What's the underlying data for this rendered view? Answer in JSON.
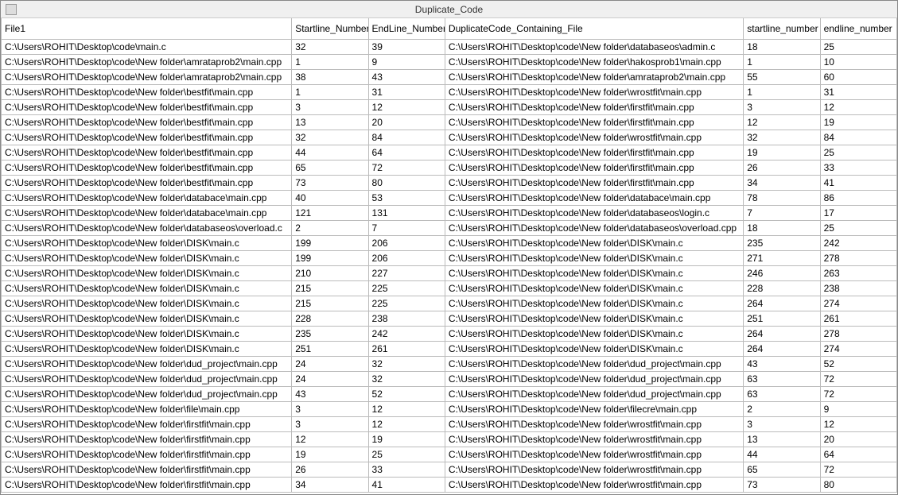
{
  "window": {
    "title": "Duplicate_Code"
  },
  "columns": {
    "file1": "File1",
    "start1": "Startline_Number",
    "end1": "EndLine_Number",
    "file2": "DuplicateCode_Containing_File",
    "start2": "startline_number",
    "end2": "endline_number"
  },
  "rows": [
    {
      "file1": "C:\\Users\\ROHIT\\Desktop\\code\\main.c",
      "start1": "32",
      "end1": "39",
      "file2": "C:\\Users\\ROHIT\\Desktop\\code\\New folder\\databaseos\\admin.c",
      "start2": "18",
      "end2": "25"
    },
    {
      "file1": "C:\\Users\\ROHIT\\Desktop\\code\\New folder\\amrataprob2\\main.cpp",
      "start1": "1",
      "end1": "9",
      "file2": "C:\\Users\\ROHIT\\Desktop\\code\\New folder\\hakosprob1\\main.cpp",
      "start2": "1",
      "end2": "10"
    },
    {
      "file1": "C:\\Users\\ROHIT\\Desktop\\code\\New folder\\amrataprob2\\main.cpp",
      "start1": "38",
      "end1": "43",
      "file2": "C:\\Users\\ROHIT\\Desktop\\code\\New folder\\amrataprob2\\main.cpp",
      "start2": "55",
      "end2": "60"
    },
    {
      "file1": "C:\\Users\\ROHIT\\Desktop\\code\\New folder\\bestfit\\main.cpp",
      "start1": "1",
      "end1": "31",
      "file2": "C:\\Users\\ROHIT\\Desktop\\code\\New folder\\wrostfit\\main.cpp",
      "start2": "1",
      "end2": "31"
    },
    {
      "file1": "C:\\Users\\ROHIT\\Desktop\\code\\New folder\\bestfit\\main.cpp",
      "start1": "3",
      "end1": "12",
      "file2": "C:\\Users\\ROHIT\\Desktop\\code\\New folder\\firstfit\\main.cpp",
      "start2": "3",
      "end2": "12"
    },
    {
      "file1": "C:\\Users\\ROHIT\\Desktop\\code\\New folder\\bestfit\\main.cpp",
      "start1": "13",
      "end1": "20",
      "file2": "C:\\Users\\ROHIT\\Desktop\\code\\New folder\\firstfit\\main.cpp",
      "start2": "12",
      "end2": "19"
    },
    {
      "file1": "C:\\Users\\ROHIT\\Desktop\\code\\New folder\\bestfit\\main.cpp",
      "start1": "32",
      "end1": "84",
      "file2": "C:\\Users\\ROHIT\\Desktop\\code\\New folder\\wrostfit\\main.cpp",
      "start2": "32",
      "end2": "84"
    },
    {
      "file1": "C:\\Users\\ROHIT\\Desktop\\code\\New folder\\bestfit\\main.cpp",
      "start1": "44",
      "end1": "64",
      "file2": "C:\\Users\\ROHIT\\Desktop\\code\\New folder\\firstfit\\main.cpp",
      "start2": "19",
      "end2": "25"
    },
    {
      "file1": "C:\\Users\\ROHIT\\Desktop\\code\\New folder\\bestfit\\main.cpp",
      "start1": "65",
      "end1": "72",
      "file2": "C:\\Users\\ROHIT\\Desktop\\code\\New folder\\firstfit\\main.cpp",
      "start2": "26",
      "end2": "33"
    },
    {
      "file1": "C:\\Users\\ROHIT\\Desktop\\code\\New folder\\bestfit\\main.cpp",
      "start1": "73",
      "end1": "80",
      "file2": "C:\\Users\\ROHIT\\Desktop\\code\\New folder\\firstfit\\main.cpp",
      "start2": "34",
      "end2": "41"
    },
    {
      "file1": "C:\\Users\\ROHIT\\Desktop\\code\\New folder\\databace\\main.cpp",
      "start1": "40",
      "end1": "53",
      "file2": "C:\\Users\\ROHIT\\Desktop\\code\\New folder\\databace\\main.cpp",
      "start2": "78",
      "end2": "86"
    },
    {
      "file1": "C:\\Users\\ROHIT\\Desktop\\code\\New folder\\databace\\main.cpp",
      "start1": "121",
      "end1": "131",
      "file2": "C:\\Users\\ROHIT\\Desktop\\code\\New folder\\databaseos\\login.c",
      "start2": "7",
      "end2": "17"
    },
    {
      "file1": "C:\\Users\\ROHIT\\Desktop\\code\\New folder\\databaseos\\overload.c",
      "start1": "2",
      "end1": "7",
      "file2": "C:\\Users\\ROHIT\\Desktop\\code\\New folder\\databaseos\\overload.cpp",
      "start2": "18",
      "end2": "25"
    },
    {
      "file1": "C:\\Users\\ROHIT\\Desktop\\code\\New folder\\DISK\\main.c",
      "start1": "199",
      "end1": "206",
      "file2": "C:\\Users\\ROHIT\\Desktop\\code\\New folder\\DISK\\main.c",
      "start2": "235",
      "end2": "242"
    },
    {
      "file1": "C:\\Users\\ROHIT\\Desktop\\code\\New folder\\DISK\\main.c",
      "start1": "199",
      "end1": "206",
      "file2": "C:\\Users\\ROHIT\\Desktop\\code\\New folder\\DISK\\main.c",
      "start2": "271",
      "end2": "278"
    },
    {
      "file1": "C:\\Users\\ROHIT\\Desktop\\code\\New folder\\DISK\\main.c",
      "start1": "210",
      "end1": "227",
      "file2": "C:\\Users\\ROHIT\\Desktop\\code\\New folder\\DISK\\main.c",
      "start2": "246",
      "end2": "263"
    },
    {
      "file1": "C:\\Users\\ROHIT\\Desktop\\code\\New folder\\DISK\\main.c",
      "start1": "215",
      "end1": "225",
      "file2": "C:\\Users\\ROHIT\\Desktop\\code\\New folder\\DISK\\main.c",
      "start2": "228",
      "end2": "238"
    },
    {
      "file1": "C:\\Users\\ROHIT\\Desktop\\code\\New folder\\DISK\\main.c",
      "start1": "215",
      "end1": "225",
      "file2": "C:\\Users\\ROHIT\\Desktop\\code\\New folder\\DISK\\main.c",
      "start2": "264",
      "end2": "274"
    },
    {
      "file1": "C:\\Users\\ROHIT\\Desktop\\code\\New folder\\DISK\\main.c",
      "start1": "228",
      "end1": "238",
      "file2": "C:\\Users\\ROHIT\\Desktop\\code\\New folder\\DISK\\main.c",
      "start2": "251",
      "end2": "261"
    },
    {
      "file1": "C:\\Users\\ROHIT\\Desktop\\code\\New folder\\DISK\\main.c",
      "start1": "235",
      "end1": "242",
      "file2": "C:\\Users\\ROHIT\\Desktop\\code\\New folder\\DISK\\main.c",
      "start2": "264",
      "end2": "278"
    },
    {
      "file1": "C:\\Users\\ROHIT\\Desktop\\code\\New folder\\DISK\\main.c",
      "start1": "251",
      "end1": "261",
      "file2": "C:\\Users\\ROHIT\\Desktop\\code\\New folder\\DISK\\main.c",
      "start2": "264",
      "end2": "274"
    },
    {
      "file1": "C:\\Users\\ROHIT\\Desktop\\code\\New folder\\dud_project\\main.cpp",
      "start1": "24",
      "end1": "32",
      "file2": "C:\\Users\\ROHIT\\Desktop\\code\\New folder\\dud_project\\main.cpp",
      "start2": "43",
      "end2": "52"
    },
    {
      "file1": "C:\\Users\\ROHIT\\Desktop\\code\\New folder\\dud_project\\main.cpp",
      "start1": "24",
      "end1": "32",
      "file2": "C:\\Users\\ROHIT\\Desktop\\code\\New folder\\dud_project\\main.cpp",
      "start2": "63",
      "end2": "72"
    },
    {
      "file1": "C:\\Users\\ROHIT\\Desktop\\code\\New folder\\dud_project\\main.cpp",
      "start1": "43",
      "end1": "52",
      "file2": "C:\\Users\\ROHIT\\Desktop\\code\\New folder\\dud_project\\main.cpp",
      "start2": "63",
      "end2": "72"
    },
    {
      "file1": "C:\\Users\\ROHIT\\Desktop\\code\\New folder\\file\\main.cpp",
      "start1": "3",
      "end1": "12",
      "file2": "C:\\Users\\ROHIT\\Desktop\\code\\New folder\\filecre\\main.cpp",
      "start2": "2",
      "end2": "9"
    },
    {
      "file1": "C:\\Users\\ROHIT\\Desktop\\code\\New folder\\firstfit\\main.cpp",
      "start1": "3",
      "end1": "12",
      "file2": "C:\\Users\\ROHIT\\Desktop\\code\\New folder\\wrostfit\\main.cpp",
      "start2": "3",
      "end2": "12"
    },
    {
      "file1": "C:\\Users\\ROHIT\\Desktop\\code\\New folder\\firstfit\\main.cpp",
      "start1": "12",
      "end1": "19",
      "file2": "C:\\Users\\ROHIT\\Desktop\\code\\New folder\\wrostfit\\main.cpp",
      "start2": "13",
      "end2": "20"
    },
    {
      "file1": "C:\\Users\\ROHIT\\Desktop\\code\\New folder\\firstfit\\main.cpp",
      "start1": "19",
      "end1": "25",
      "file2": "C:\\Users\\ROHIT\\Desktop\\code\\New folder\\wrostfit\\main.cpp",
      "start2": "44",
      "end2": "64"
    },
    {
      "file1": "C:\\Users\\ROHIT\\Desktop\\code\\New folder\\firstfit\\main.cpp",
      "start1": "26",
      "end1": "33",
      "file2": "C:\\Users\\ROHIT\\Desktop\\code\\New folder\\wrostfit\\main.cpp",
      "start2": "65",
      "end2": "72"
    },
    {
      "file1": "C:\\Users\\ROHIT\\Desktop\\code\\New folder\\firstfit\\main.cpp",
      "start1": "34",
      "end1": "41",
      "file2": "C:\\Users\\ROHIT\\Desktop\\code\\New folder\\wrostfit\\main.cpp",
      "start2": "73",
      "end2": "80"
    }
  ]
}
